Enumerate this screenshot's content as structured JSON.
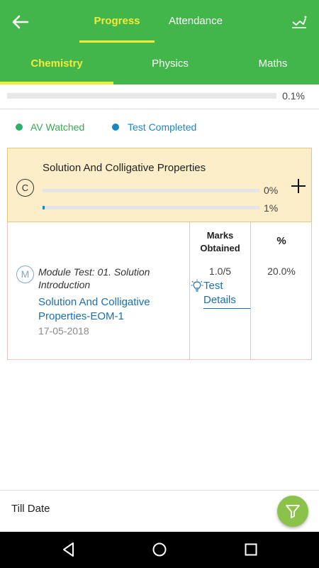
{
  "header": {
    "tabs": [
      {
        "label": "Progress",
        "active": true
      },
      {
        "label": "Attendance",
        "active": false
      }
    ],
    "back_icon": "arrow-left-icon",
    "chart_icon": "trend-chart-icon"
  },
  "subjects": [
    {
      "label": "Chemistry",
      "active": true
    },
    {
      "label": "Physics",
      "active": false
    },
    {
      "label": "Maths",
      "active": false
    }
  ],
  "overall": {
    "percent_text": "0.1%",
    "progress_fraction": 0.001
  },
  "legend": {
    "av_label": "AV Watched",
    "test_label": "Test Completed",
    "av_color": "#2cb06a",
    "test_color": "#1b86c2"
  },
  "chapter": {
    "badge": "C",
    "title": "Solution And Colligative Properties",
    "av_percent_text": "0%",
    "av_fraction": 0.0,
    "test_percent_text": "1%",
    "test_fraction": 0.01,
    "expand_icon": "plus-icon"
  },
  "table": {
    "header_marks": "Marks Obtained",
    "header_percent": "%",
    "rows": [
      {
        "badge": "M",
        "test_name": "Module Test: 01. Solution Introduction",
        "link": "Solution And Colligative Properties-EOM-1",
        "date": "17-05-2018",
        "marks": "1.0/5",
        "percent": "20.0%",
        "details_label": "Test Details",
        "details_icon": "lightbulb-icon"
      }
    ]
  },
  "footer": {
    "till_label": "Till Date",
    "filter_icon": "filter-icon"
  },
  "navbar": {
    "back_icon": "nav-back-icon",
    "home_icon": "nav-home-icon",
    "recent_icon": "nav-recent-icon"
  },
  "colors": {
    "primary": "#42b64a",
    "accent": "#f5e93a",
    "card_bg": "#fbeec8",
    "fab": "#8bc34a"
  }
}
